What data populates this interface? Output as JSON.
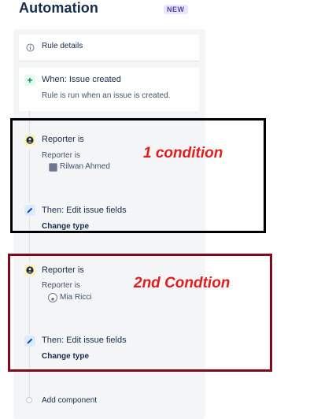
{
  "header": {
    "title": "Automation",
    "badge": "NEW"
  },
  "rule_details": {
    "label": "Rule details",
    "icon": "info-icon"
  },
  "trigger": {
    "title": "When: Issue created",
    "description": "Rule is run when an issue is created.",
    "icon": "plus-icon"
  },
  "block1": {
    "condition_title": "Reporter is",
    "condition_sub": "Reporter is",
    "user_name": "Rilwan Ahmed",
    "action_title": "Then: Edit issue fields",
    "action_detail": "Change type"
  },
  "block2": {
    "condition_title": "Reporter is",
    "condition_sub": "Reporter is",
    "user_name": "Mia Ricci",
    "action_title": "Then: Edit issue fields",
    "action_detail": "Change type"
  },
  "annotations": {
    "first": "1 condition",
    "second": "2nd Condtion"
  },
  "add_component": {
    "label": "Add component"
  },
  "colors": {
    "box1_border": "#000000",
    "box2_border": "#7f0a1a",
    "annotation_text": "#e01e1e",
    "badge_bg": "#eae6ff",
    "badge_text": "#5243aa"
  }
}
